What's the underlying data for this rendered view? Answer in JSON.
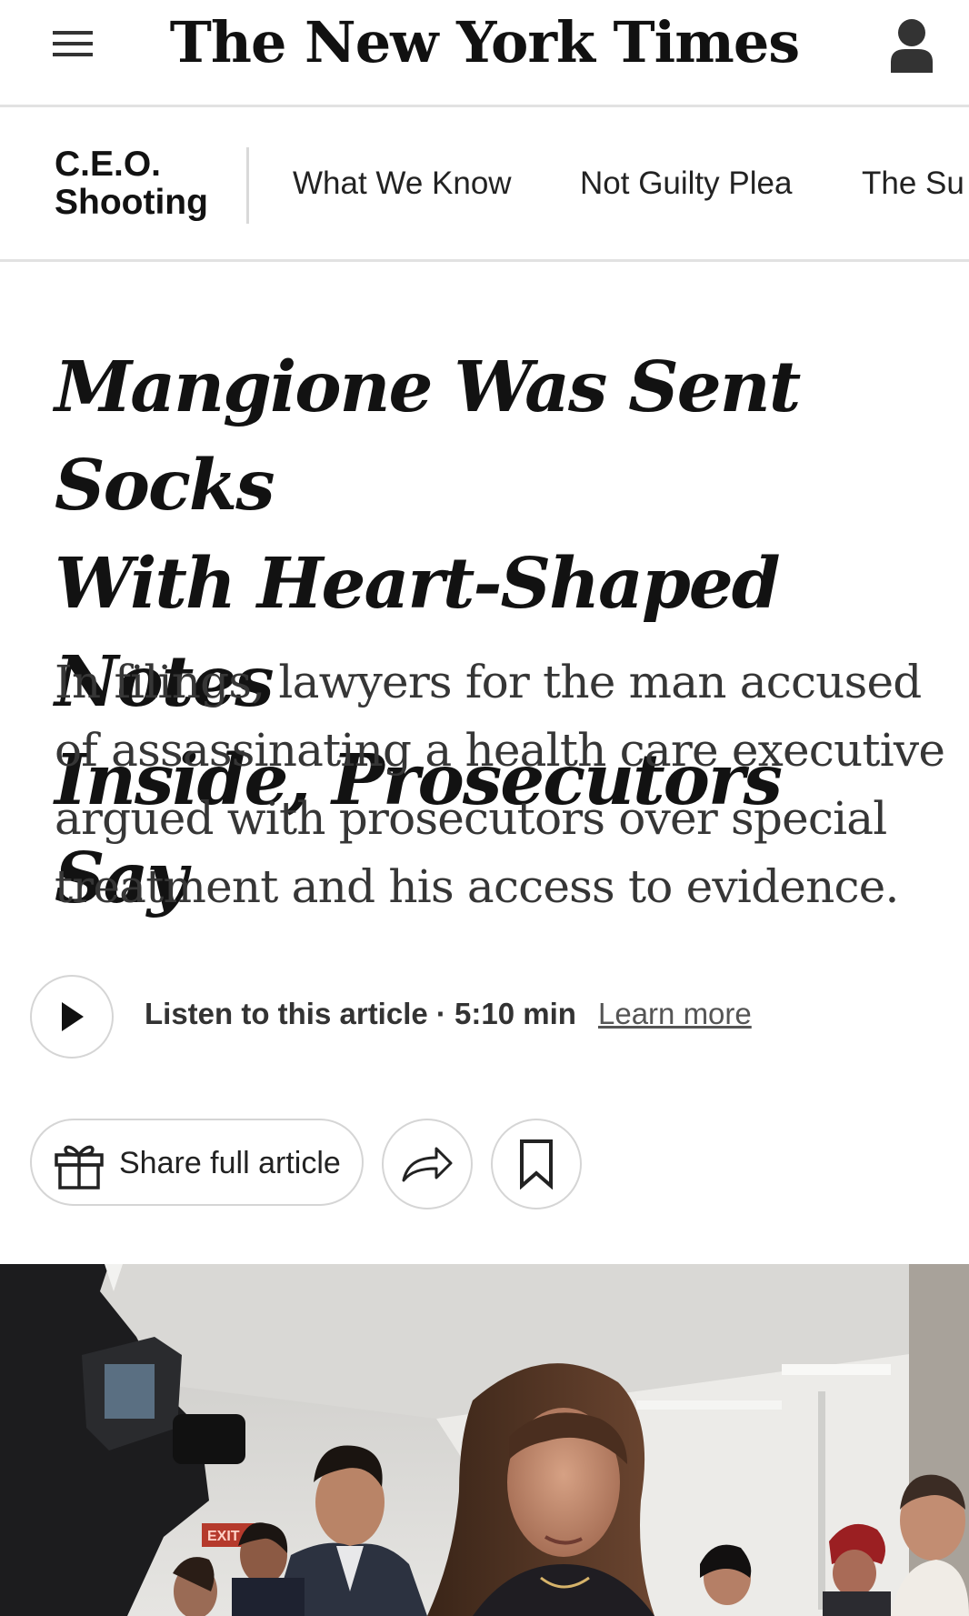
{
  "masthead": {
    "logo_text": "The New York Times",
    "menu_icon": "hamburger-menu-icon",
    "account_icon": "account-icon"
  },
  "section_nav": {
    "title_line1": "C.E.O.",
    "title_line2": "Shooting",
    "links": [
      "What We Know",
      "Not Guilty Plea",
      "The Su"
    ]
  },
  "article": {
    "headline_lines": [
      "Mangione Was Sent Socks",
      "With Heart-Shaped Notes",
      "Inside, Prosecutors Say"
    ],
    "summary_lines": [
      "In filings, lawyers for the man accused",
      "of assassinating a health care executive",
      "argued with prosecutors over special",
      "treatment and his access to evidence."
    ]
  },
  "listen": {
    "label": "Listen to this article · 5:10 min",
    "learn_more": "Learn more",
    "play_icon": "play-icon"
  },
  "share": {
    "share_label": "Share full article",
    "gift_icon": "gift-icon",
    "share_icon": "share-arrow-icon",
    "save_icon": "bookmark-icon"
  },
  "photo": {
    "exit_sign": "EXIT"
  }
}
